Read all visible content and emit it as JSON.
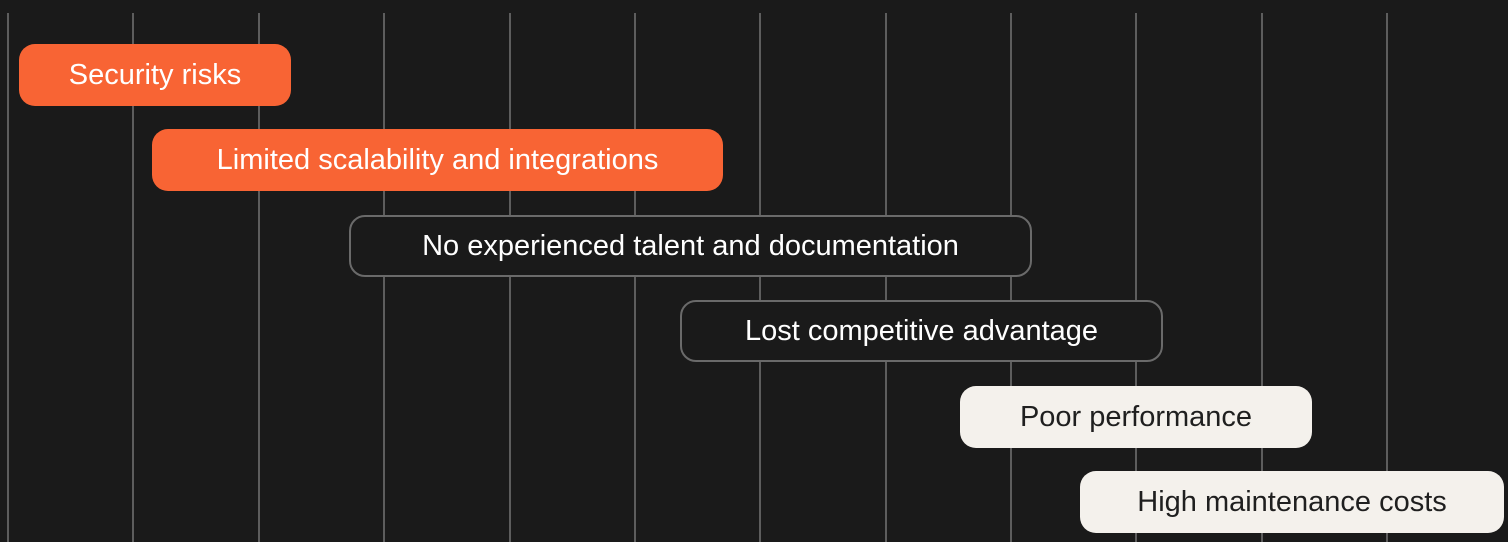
{
  "colors": {
    "background": "#1a1a1a",
    "gridline": "#5d5d5d",
    "accent_orange": "#f86434",
    "outline_border": "#6a6a6a",
    "light_fill": "#f4f1ec",
    "text_light": "#ffffff",
    "text_dark": "#1f1f1f"
  },
  "items": [
    {
      "label": "Security risks",
      "style": "orange"
    },
    {
      "label": "Limited scalability and integrations",
      "style": "orange"
    },
    {
      "label": "No experienced talent and documentation",
      "style": "outline"
    },
    {
      "label": "Lost competitive advantage",
      "style": "outline"
    },
    {
      "label": "Poor performance",
      "style": "light"
    },
    {
      "label": "High maintenance costs",
      "style": "light"
    }
  ]
}
